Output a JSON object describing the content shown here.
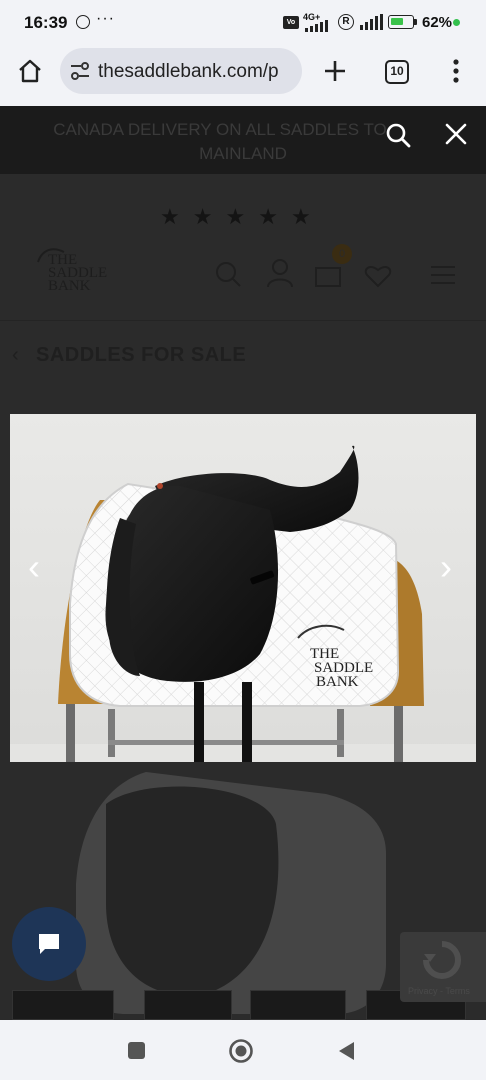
{
  "status_bar": {
    "time": "16:39",
    "network": "4G+",
    "roaming": "R",
    "battery_pct": "62%",
    "battery_level": 0.62
  },
  "browser": {
    "url": "thesaddlebank.com/p",
    "tab_count": "10"
  },
  "page": {
    "banner_line1": "CANADA DELIVERY ON ALL SADDLES TO",
    "banner_line2": "MAINLAND",
    "rating_stars": 5,
    "logo_lines": [
      "THE",
      "SADDLE",
      "BANK"
    ],
    "cart_count": "0",
    "breadcrumb_title": "SADDLES FOR SALE"
  },
  "photo": {
    "watermark_lines": [
      "THE",
      "SADDLE",
      "BANK"
    ]
  },
  "recaptcha": {
    "label": "Privacy - Terms"
  },
  "colors": {
    "overlay": "#2b2b2b",
    "chat_button": "#1e3557",
    "battery_green": "#3ac24a"
  }
}
